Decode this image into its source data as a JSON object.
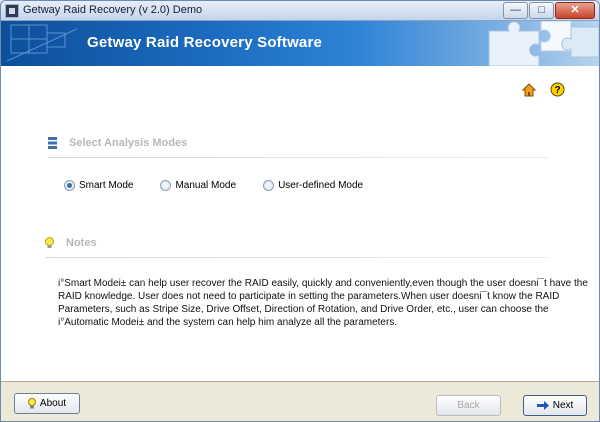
{
  "window": {
    "title": "Getway Raid Recovery (v 2.0) Demo",
    "controls": [
      "minimize",
      "maximize",
      "close"
    ]
  },
  "banner": {
    "title": "Getway Raid Recovery Software"
  },
  "toolbar": {
    "home_icon": "home-icon",
    "help_icon": "help-icon"
  },
  "analysis": {
    "heading": "Select Analysis Modes",
    "icon": "list-icon",
    "modes": [
      {
        "label": "Smart Mode",
        "selected": true
      },
      {
        "label": "Manual Mode",
        "selected": false
      },
      {
        "label": "User-defined Mode",
        "selected": false
      }
    ]
  },
  "notes": {
    "heading": "Notes",
    "icon": "lightbulb-icon",
    "text": "i°Smart Modei± can help user recover the RAID easily, quickly and conveniently,even though the user doesni¯t have the RAID knowledge. User does not need to participate in setting the parameters.When user doesni¯t know the RAID Parameters, such as Stripe Size, Drive Offset, Direction of Rotation, and Drive Order,  etc., user can choose the i°Automatic Modei± and the system can help him analyze all the parameters."
  },
  "footer": {
    "about_label": "About",
    "back_label": "Back",
    "next_label": "Next"
  },
  "colors": {
    "banner_start": "#0d4f9a",
    "banner_end": "#b7d3ee",
    "heading_gray": "#b7b7b7",
    "radio_dot": "#3b6fb6"
  }
}
